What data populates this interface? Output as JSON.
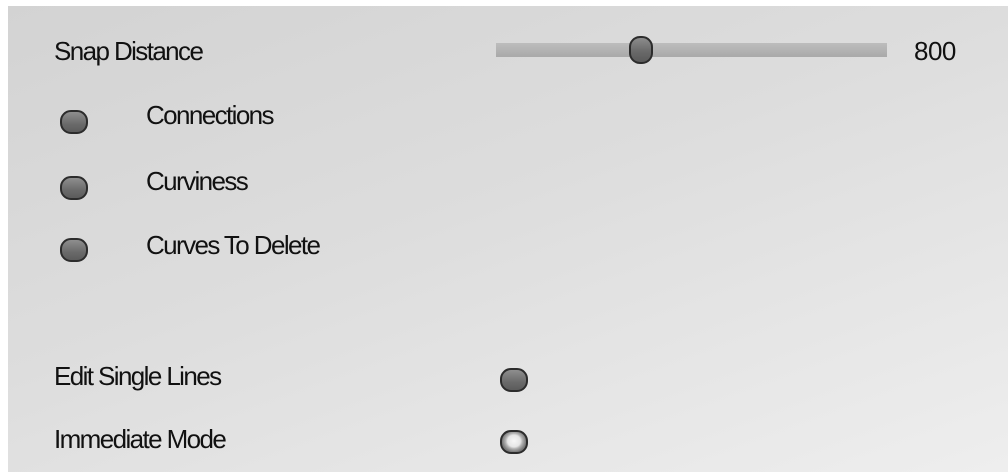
{
  "snap_distance": {
    "label": "Snap Distance",
    "value_text": "800",
    "level_fraction": 0.37
  },
  "options": [
    {
      "label": "Connections",
      "checked": false
    },
    {
      "label": "Curviness",
      "checked": false
    },
    {
      "label": "Curves To Delete",
      "checked": false
    }
  ],
  "edit_single_lines": {
    "label": "Edit Single Lines",
    "checked": false
  },
  "immediate_mode": {
    "label": "Immediate Mode",
    "checked": true
  }
}
